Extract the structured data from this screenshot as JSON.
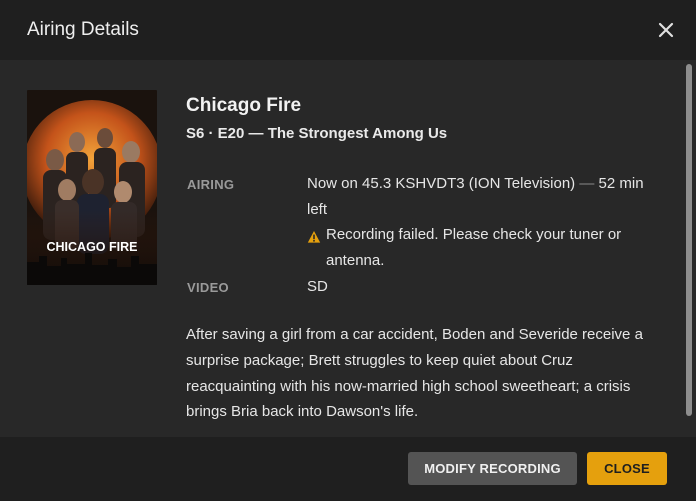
{
  "header": {
    "title": "Airing Details"
  },
  "show": {
    "title": "Chicago Fire",
    "episode": "S6 · E20 — The Strongest Among Us",
    "poster_text": "CHICAGO FIRE"
  },
  "details": {
    "airing_label": "AIRING",
    "airing_now": "Now on 45.3 KSHVDT3 (ION Television)",
    "airing_dash": "—",
    "airing_left": "52 min left",
    "warning": "Recording failed. Please check your tuner or antenna.",
    "video_label": "VIDEO",
    "video_value": "SD"
  },
  "summary": "After saving a girl from a car accident, Boden and Severide receive a surprise package; Brett struggles to keep quiet about Cruz reacquainting with his now-married high school sweetheart; a crisis brings Bria back into Dawson's life.",
  "footer": {
    "modify_label": "MODIFY RECORDING",
    "close_label": "CLOSE"
  },
  "colors": {
    "accent": "#e5a00d",
    "warning": "#e5a00d",
    "background": "#282828",
    "header": "#1f1f1f"
  },
  "icons": {
    "close": "close-icon",
    "warning": "warning-icon"
  }
}
